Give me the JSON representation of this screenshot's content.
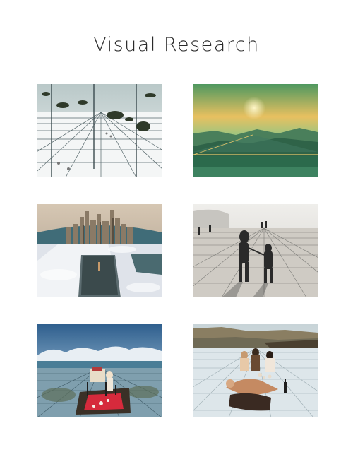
{
  "page": {
    "title": "Visual Research"
  },
  "gallery": {
    "images": [
      {
        "name": "grid-mirror-room-image",
        "palette": {
          "floor": "#e9eef0",
          "grid": "#4a5a5e",
          "sky": "#cfd9da"
        }
      },
      {
        "name": "green-sunset-landscape-image",
        "palette": {
          "sky": "#6fae74",
          "sun": "#f3d36b",
          "ground": "#2f6e52"
        }
      },
      {
        "name": "city-skyline-grid-image",
        "palette": {
          "sky": "#c9b9a4",
          "grid": "#d8dde4",
          "water": "#3f6f7c"
        }
      },
      {
        "name": "couple-on-grid-bw-image",
        "palette": {
          "ground": "#d9d6d0",
          "grid": "#6e6e6e",
          "figure": "#2a2a2a"
        }
      },
      {
        "name": "picnic-on-grid-sea-image",
        "palette": {
          "sky": "#3a6e9c",
          "sea": "#5a88a0",
          "blanket": "#d8283a"
        }
      },
      {
        "name": "group-on-grid-cliff-image",
        "palette": {
          "cliff": "#7a6e52",
          "grid": "#b6c3c6",
          "figures": "#4a3a2a"
        }
      }
    ]
  }
}
